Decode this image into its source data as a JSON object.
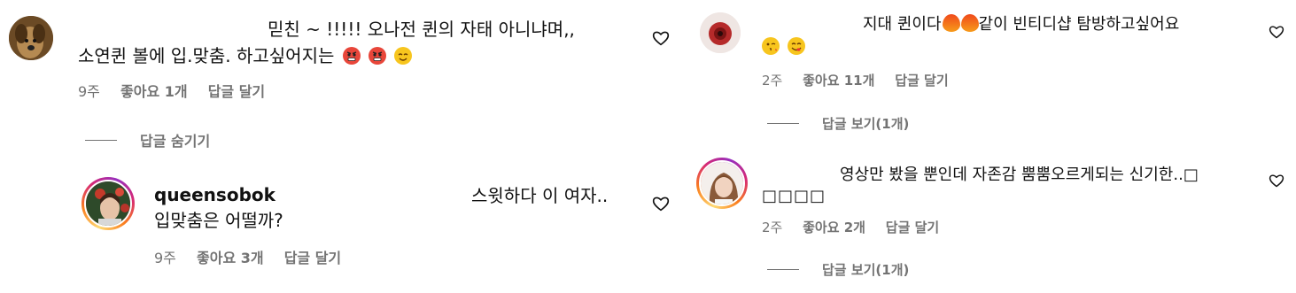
{
  "left": {
    "comment1": {
      "text_line1": "믿친 ~ !!!!! 오나전 퀸의 자태 아니냐며,,",
      "text_line2": "소연퀸 볼에 입.맞춤. 하고싶어지는",
      "emojis": [
        "angry-face",
        "angry-face",
        "relieved-face"
      ],
      "time": "9주",
      "likes": "좋아요 1개",
      "reply": "답글 달기"
    },
    "hide_replies": "답글 숨기기",
    "reply1": {
      "username": "queensobok",
      "text_line1": "스윗하다 이 여자..",
      "text_line2": "입맞춤은 어떨까?",
      "time": "9주",
      "likes": "좋아요 3개",
      "reply": "답글 달기"
    }
  },
  "right": {
    "comment1": {
      "text_line1": "지대 퀸이다",
      "text_line1b": "같이 빈티디샵 탐방하고싶어요",
      "emojis_inline": [
        "fire",
        "fire"
      ],
      "emojis_line2": [
        "kiss-face",
        "yum-face"
      ],
      "time": "2주",
      "likes": "좋아요 11개",
      "reply": "답글 달기",
      "view_replies": "답글 보기(1개)"
    },
    "comment2": {
      "text_line1": "영상만 봤을 뿐인데 자존감 뿜뿜오르게되는 신기한..",
      "text_line1_tail": "□",
      "text_line2": "□□□□",
      "time": "2주",
      "likes": "좋아요 2개",
      "reply": "답글 달기",
      "view_replies": "답글 보기(1개)"
    }
  },
  "colors": {
    "text": "#111111",
    "meta": "#737373",
    "background": "#ffffff"
  }
}
